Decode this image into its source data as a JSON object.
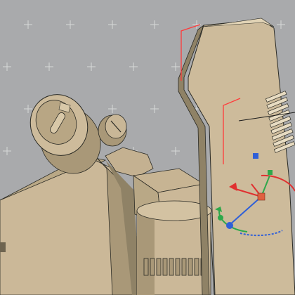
{
  "viewport": {
    "background": "#a9aaac",
    "grid_color": "#ffffff",
    "model_color": "#cbb898",
    "model_shadow_color": "#8f8266",
    "edge_color": "#2a2a24"
  },
  "gizmo": {
    "x_axis_color": "#e03030",
    "y_axis_color": "#2ea84a",
    "z_axis_color": "#2f5fd8",
    "pivot_axis_color": "#ff3a3a"
  },
  "icons": [
    "cad-viewport",
    "move-rotate-gizmo",
    "pivot-axis-marker",
    "selection-bracket"
  ]
}
